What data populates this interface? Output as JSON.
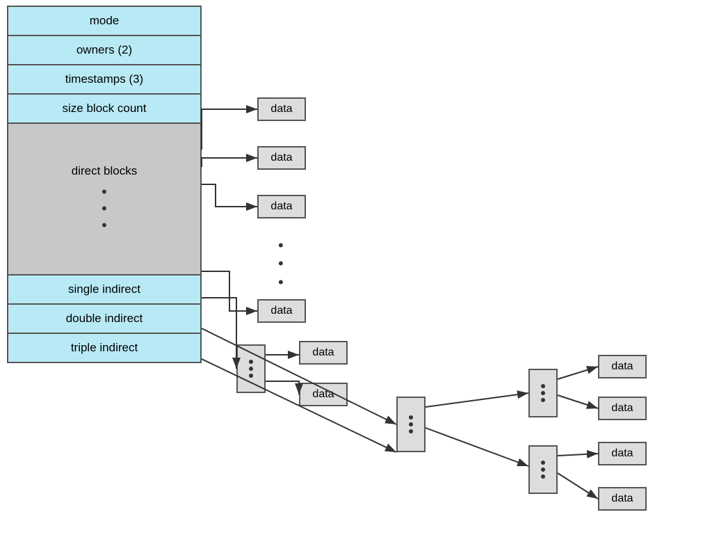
{
  "inode": {
    "cells": [
      {
        "label": "mode",
        "type": "blue"
      },
      {
        "label": "owners (2)",
        "type": "blue"
      },
      {
        "label": "timestamps (3)",
        "type": "blue"
      },
      {
        "label": "size block count",
        "type": "blue"
      },
      {
        "label": "direct blocks",
        "type": "gray",
        "tall": true
      },
      {
        "label": "single indirect",
        "type": "light-blue"
      },
      {
        "label": "double indirect",
        "type": "light-blue"
      },
      {
        "label": "triple indirect",
        "type": "light-blue"
      }
    ]
  },
  "data_boxes": [
    {
      "id": "d1",
      "label": "data"
    },
    {
      "id": "d2",
      "label": "data"
    },
    {
      "id": "d3",
      "label": "data"
    },
    {
      "id": "d4",
      "label": "data"
    },
    {
      "id": "d5",
      "label": "data"
    },
    {
      "id": "d6",
      "label": "data"
    },
    {
      "id": "d7",
      "label": "data"
    },
    {
      "id": "d8",
      "label": "data"
    },
    {
      "id": "d9",
      "label": "data"
    },
    {
      "id": "d10",
      "label": "data"
    }
  ],
  "dots": "•\n•\n•"
}
